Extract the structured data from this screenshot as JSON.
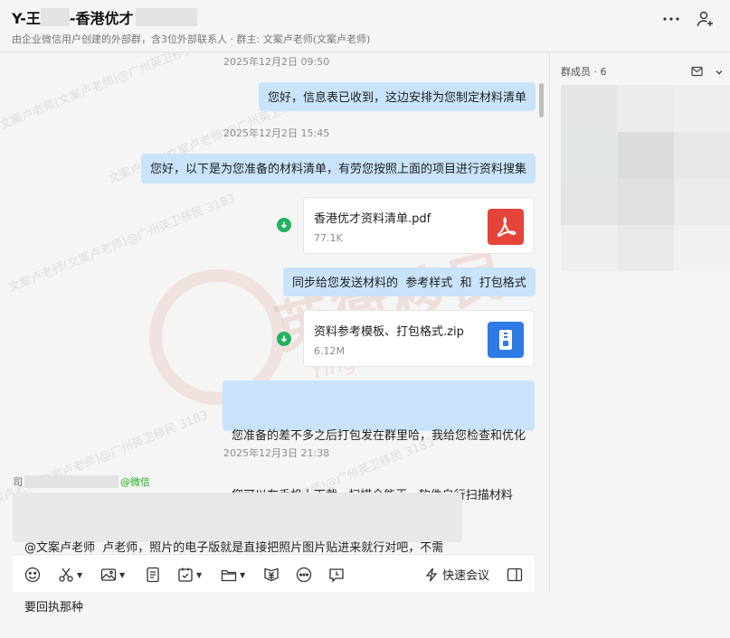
{
  "header": {
    "title_prefix": "Y-王",
    "title_suffix": "-香港优才",
    "subtitle": "由企业微信用户创建的外部群，含3位外部联系人 · 群主: 文案卢老师(文案卢老师)",
    "icons": [
      "more-icon",
      "add-member-icon"
    ]
  },
  "messages": {
    "ts1": "2025年12月2日 09:50",
    "msg1": "您好，信息表已收到，这边安排为您制定材料清单",
    "ts2": "2025年12月2日 15:45",
    "msg2": "您好，以下是为您准备的材料清单，有劳您按照上面的项目进行资料搜集",
    "file1": {
      "name": "香港优才资料清单.pdf",
      "size": "77.1K",
      "icon": "pdf-icon",
      "color": "#e5443b"
    },
    "msg3": "同步给您发送材料的  参考样式  和  打包格式",
    "file2": {
      "name": "资料参考模板、打包格式.zip",
      "size": "6.12M",
      "icon": "zip-icon",
      "color": "#2e7be6"
    },
    "msg4_line1": "您准备的差不多之后打包发在群里哈，我给您检查和优化",
    "msg4_line2": "您可以在手机上下载   扫描全能王   软件自行扫描材料",
    "ts3": "2025年12月3日 21:38",
    "sender_prefix": "司",
    "sender_tag": "@微信",
    "msg5_line1": "@文案卢老师  卢老师，照片的电子版就是直接把照片图片贴进来就行对吧，不需",
    "msg5_line2": "要回执那种"
  },
  "composer": {
    "tools": [
      "emoji-icon",
      "scissors-icon",
      "image-icon",
      "doc-icon",
      "todo-icon",
      "folder-icon",
      "payment-icon",
      "more-dots-icon",
      "clock-icon"
    ],
    "meeting_label": "快速会议"
  },
  "sidebar": {
    "members_label": "群成员 · 6"
  },
  "watermark": {
    "text": "文案卢老师(文案卢老师)@广州英卫移民 3183",
    "brand": "英衞移民",
    "brand_en": "Yingwei immigration"
  }
}
